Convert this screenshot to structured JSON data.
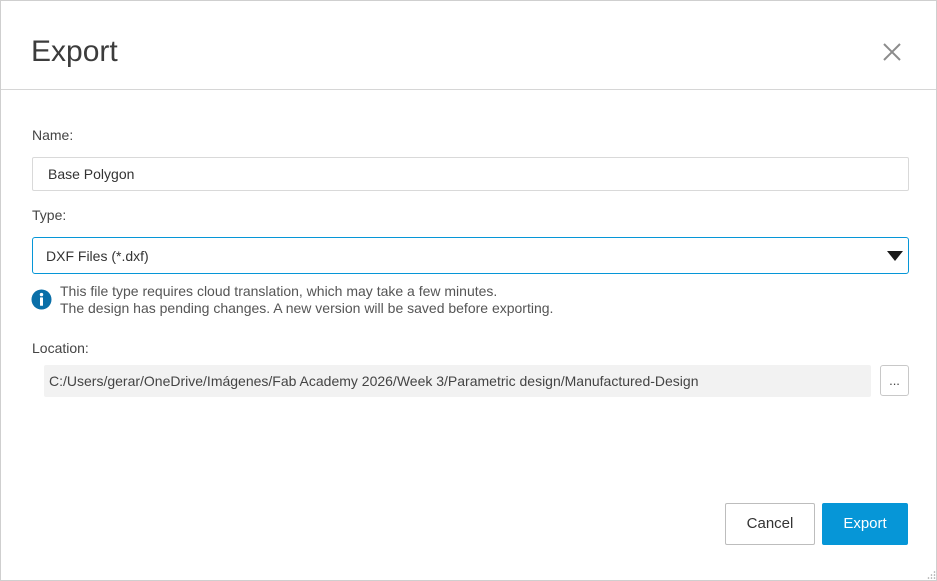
{
  "dialog": {
    "title": "Export",
    "close_icon": "close-icon"
  },
  "form": {
    "name_label": "Name:",
    "name_value": "Base Polygon",
    "type_label": "Type:",
    "type_selected": "DXF Files (*.dxf)",
    "info_icon": "info-icon",
    "info_lines": [
      "This file type requires cloud translation, which may take a few minutes.",
      "The design has pending changes. A new version will be saved before exporting."
    ],
    "location_label": "Location:",
    "location_path": "C:/Users/gerar/OneDrive/Imágenes/Fab Academy 2026/Week 3/Parametric design/Manufactured-Design",
    "browse_label": "..."
  },
  "actions": {
    "cancel_label": "Cancel",
    "export_label": "Export"
  },
  "colors": {
    "accent": "#0696d7",
    "info_icon": "#0a6fa8",
    "location_bg": "#f2f2f2"
  }
}
